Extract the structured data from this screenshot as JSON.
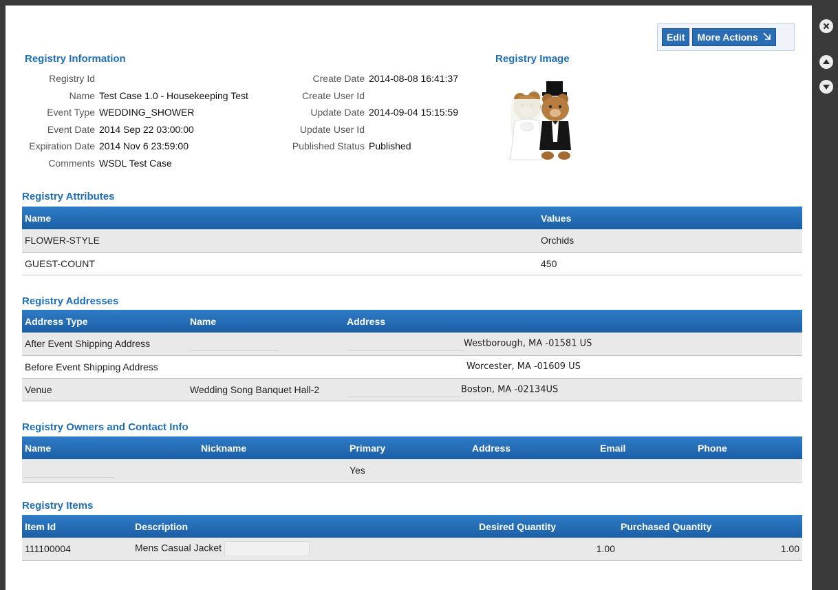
{
  "actions": {
    "edit_label": "Edit",
    "more_actions_label": "More Actions"
  },
  "icons": {
    "close": "close-circle-icon",
    "up": "arrow-up-circle-icon",
    "down": "arrow-down-circle-icon",
    "more": "arrow-down-right-icon"
  },
  "colors": {
    "accent": "#1f6fb8",
    "header_bar": "#2a6db4",
    "row_alt": "#e9e9e9",
    "frame": "#3a3a3a"
  },
  "registry_info": {
    "title": "Registry Information",
    "left": [
      {
        "label": "Registry Id",
        "value": ""
      },
      {
        "label": "Name",
        "value": "Test Case 1.0 - Housekeeping Test"
      },
      {
        "label": "Event Type",
        "value": "WEDDING_SHOWER"
      },
      {
        "label": "Event Date",
        "value": "2014 Sep 22 03:00:00"
      },
      {
        "label": "Expiration Date",
        "value": "2014 Nov 6 23:59:00"
      },
      {
        "label": "Comments",
        "value": "WSDL Test Case"
      }
    ],
    "right": [
      {
        "label": "Create Date",
        "value": "2014-08-08 16:41:37"
      },
      {
        "label": "Create User Id",
        "value": ""
      },
      {
        "label": "Update Date",
        "value": "2014-09-04 15:15:59"
      },
      {
        "label": "Update User Id",
        "value": ""
      },
      {
        "label": "Published Status",
        "value": "Published"
      }
    ]
  },
  "registry_image": {
    "title": "Registry Image"
  },
  "attributes": {
    "title": "Registry Attributes",
    "columns": [
      "Name",
      "Values"
    ],
    "rows": [
      [
        "FLOWER-STYLE",
        "Orchids"
      ],
      [
        "GUEST-COUNT",
        "450"
      ]
    ]
  },
  "addresses": {
    "title": "Registry Addresses",
    "columns": [
      "Address Type",
      "Name",
      "Address"
    ],
    "rows": [
      [
        "After Event Shipping Address",
        "",
        "Westborough, MA -01581 US"
      ],
      [
        "Before Event Shipping Address",
        "",
        "Worcester, MA -01609 US"
      ],
      [
        "Venue",
        "Wedding Song Banquet Hall-2",
        "Boston, MA -02134US"
      ]
    ]
  },
  "owners": {
    "title": "Registry Owners and Contact Info",
    "columns": [
      "Name",
      "Nickname",
      "Primary",
      "Address",
      "Email",
      "Phone"
    ],
    "rows": [
      [
        "",
        "",
        "Yes",
        "",
        "",
        ""
      ]
    ]
  },
  "items": {
    "title": "Registry Items",
    "columns": [
      "Item Id",
      "Description",
      "Desired Quantity",
      "Purchased Quantity"
    ],
    "rows": [
      [
        "111100004",
        "Mens Casual Jacket",
        "1.00",
        "1.00"
      ]
    ]
  }
}
